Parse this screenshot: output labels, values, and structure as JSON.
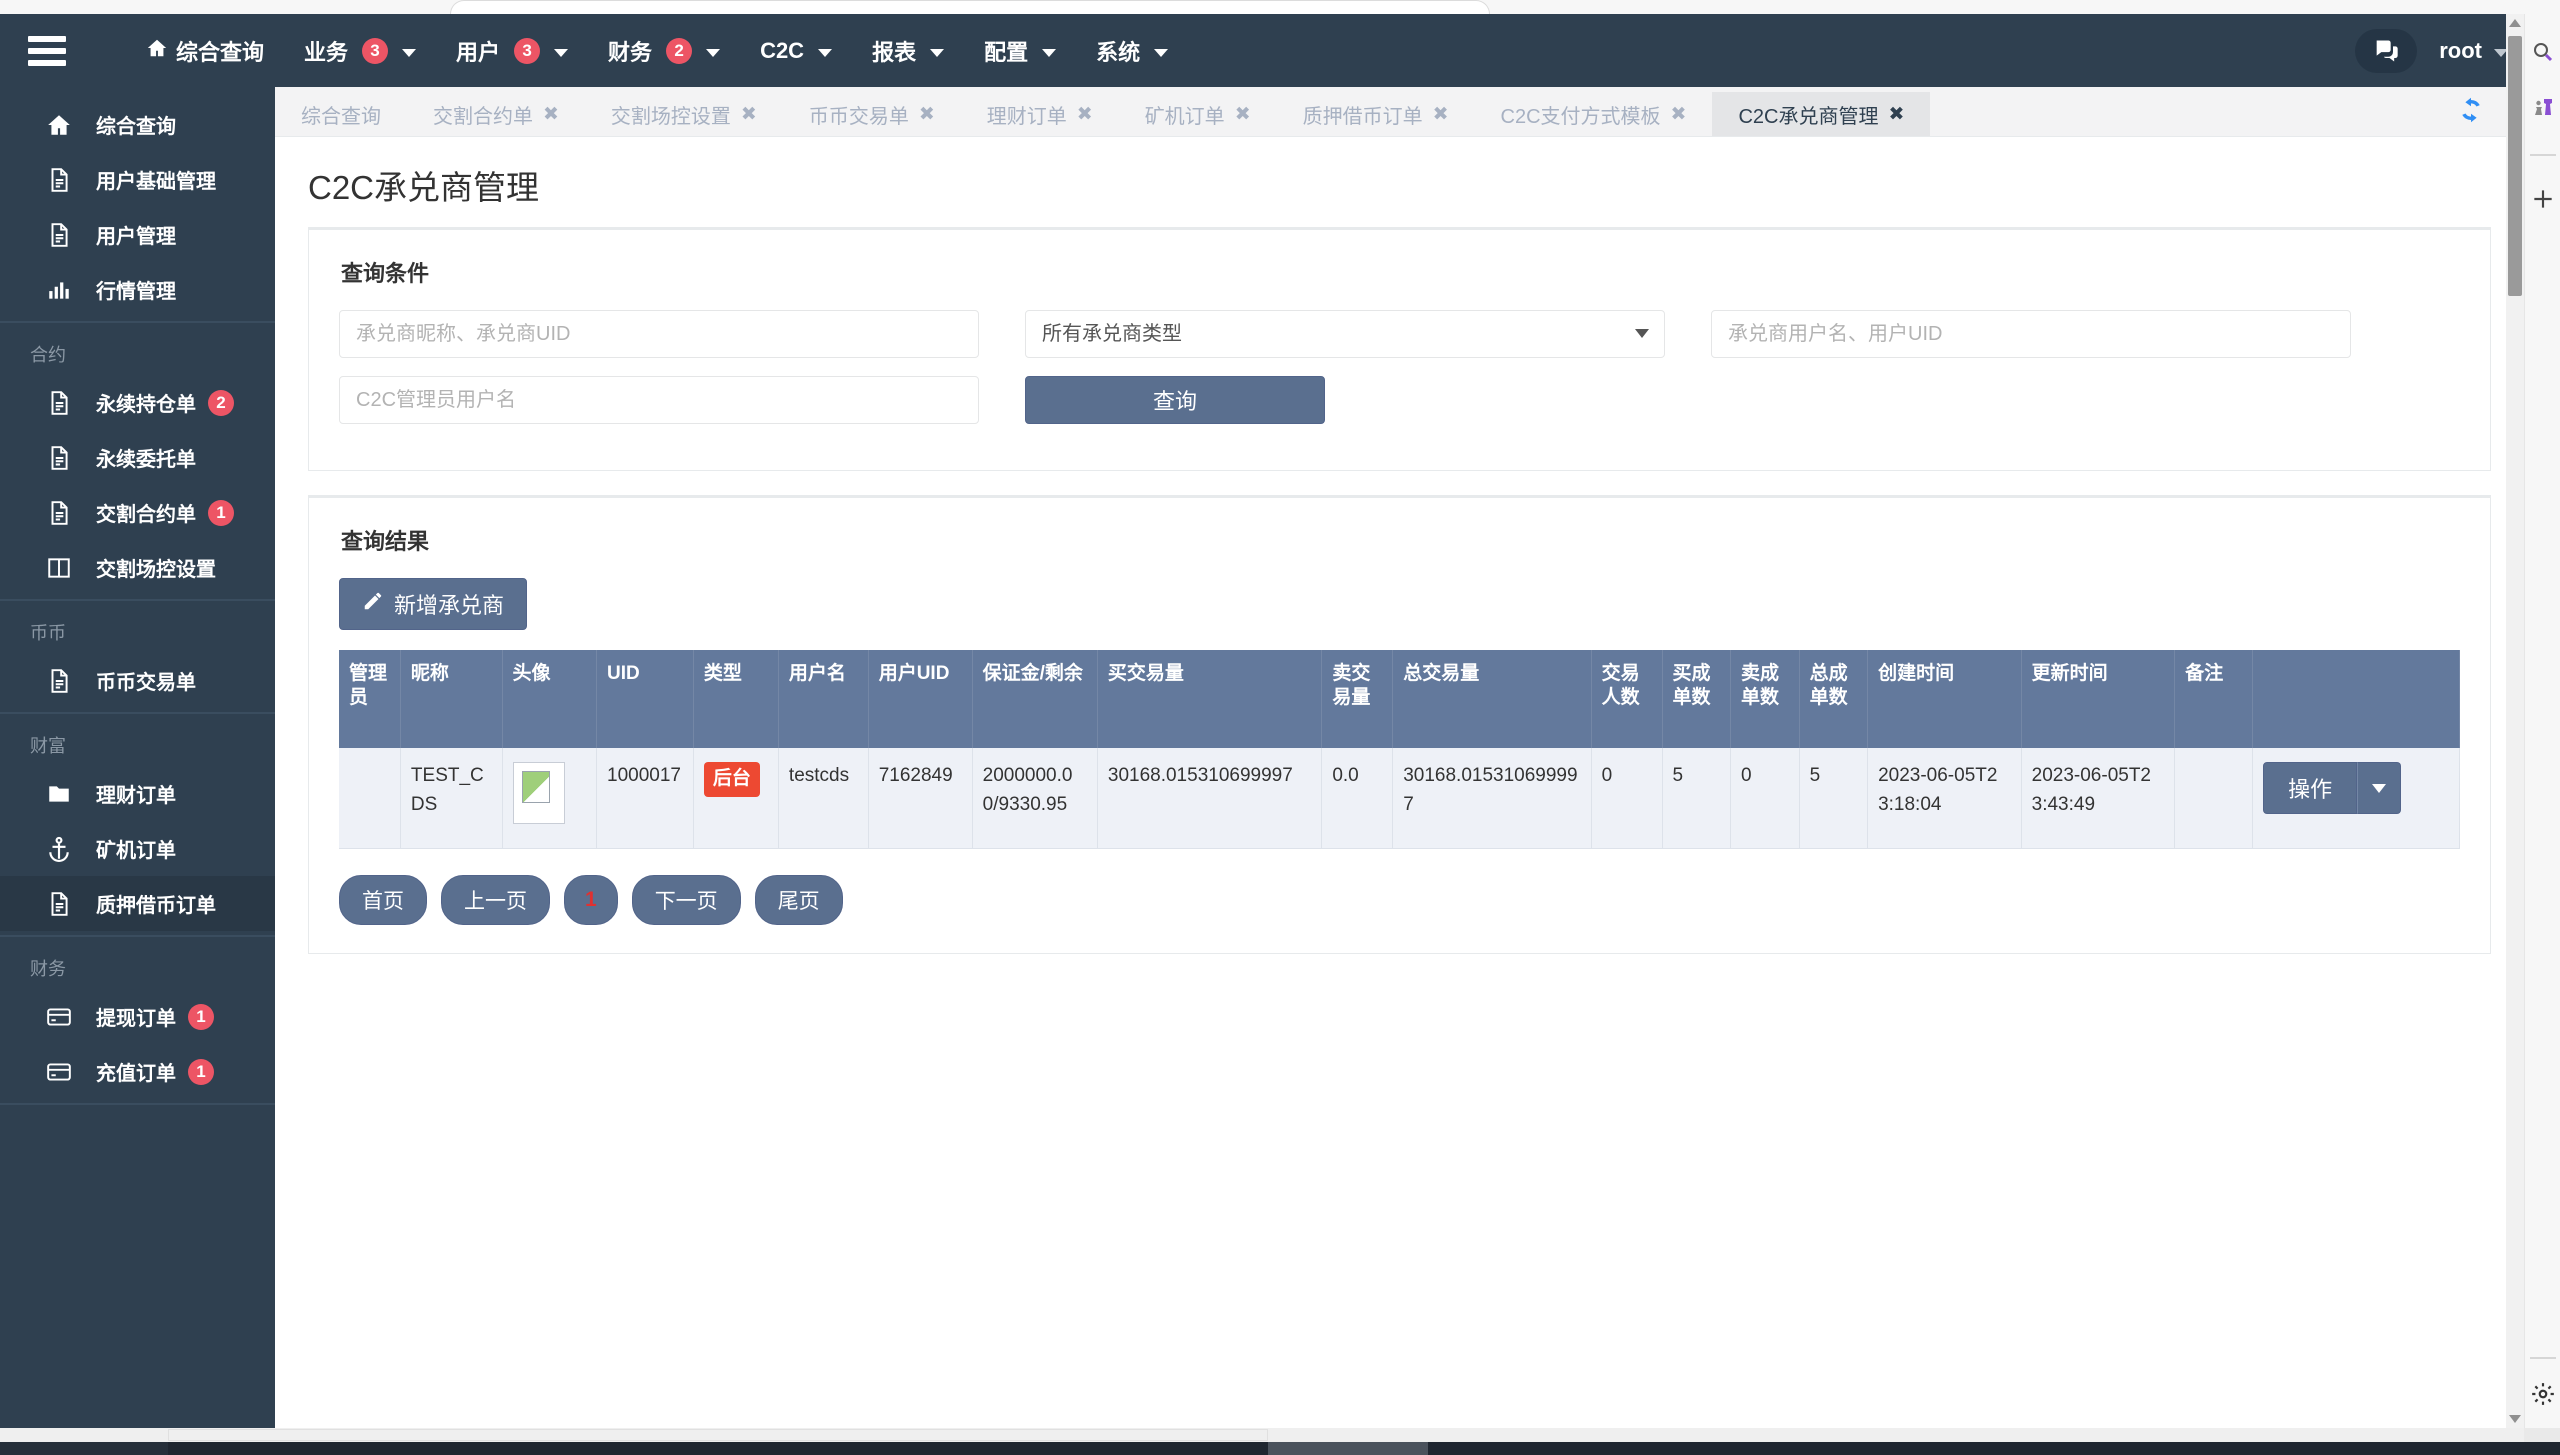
{
  "navbar": {
    "hamburger": "menu-icon",
    "items": [
      {
        "label": "综合查询",
        "icon": "home-icon",
        "badge": null,
        "caret": false
      },
      {
        "label": "业务",
        "icon": null,
        "badge": "3",
        "caret": true
      },
      {
        "label": "用户",
        "icon": null,
        "badge": "3",
        "caret": true
      },
      {
        "label": "财务",
        "icon": null,
        "badge": "2",
        "caret": true
      },
      {
        "label": "C2C",
        "icon": null,
        "badge": null,
        "caret": true
      },
      {
        "label": "报表",
        "icon": null,
        "badge": null,
        "caret": true
      },
      {
        "label": "配置",
        "icon": null,
        "badge": null,
        "caret": true
      },
      {
        "label": "系统",
        "icon": null,
        "badge": null,
        "caret": true
      }
    ],
    "chat_icon": "chat-bubbles-icon",
    "user": "root"
  },
  "sidebar": {
    "groups": [
      {
        "title": null,
        "items": [
          {
            "label": "综合查询",
            "icon": "home-icon",
            "badge": null,
            "active": false
          },
          {
            "label": "用户基础管理",
            "icon": "file-icon",
            "badge": null,
            "active": false
          },
          {
            "label": "用户管理",
            "icon": "file-icon",
            "badge": null,
            "active": false
          },
          {
            "label": "行情管理",
            "icon": "chart-bar-icon",
            "badge": null,
            "active": false
          }
        ]
      },
      {
        "title": "合约",
        "items": [
          {
            "label": "永续持仓单",
            "icon": "file-icon",
            "badge": "2",
            "active": false
          },
          {
            "label": "永续委托单",
            "icon": "file-icon",
            "badge": null,
            "active": false
          },
          {
            "label": "交割合约单",
            "icon": "file-icon",
            "badge": "1",
            "active": false
          },
          {
            "label": "交割场控设置",
            "icon": "columns-icon",
            "badge": null,
            "active": false
          }
        ]
      },
      {
        "title": "币币",
        "items": [
          {
            "label": "币币交易单",
            "icon": "file-icon",
            "badge": null,
            "active": false
          }
        ]
      },
      {
        "title": "财富",
        "items": [
          {
            "label": "理财订单",
            "icon": "folder-icon",
            "badge": null,
            "active": false
          },
          {
            "label": "矿机订单",
            "icon": "anchor-icon",
            "badge": null,
            "active": false
          },
          {
            "label": "质押借币订单",
            "icon": "file-icon",
            "badge": null,
            "active": true
          }
        ]
      },
      {
        "title": "财务",
        "items": [
          {
            "label": "提现订单",
            "icon": "credit-card-icon",
            "badge": "1",
            "active": false
          },
          {
            "label": "充值订单",
            "icon": "credit-card-icon",
            "badge": "1",
            "active": false
          }
        ]
      }
    ]
  },
  "tabs": {
    "items": [
      {
        "label": "综合查询",
        "closable": false,
        "active": false
      },
      {
        "label": "交割合约单",
        "closable": true,
        "active": false
      },
      {
        "label": "交割场控设置",
        "closable": true,
        "active": false
      },
      {
        "label": "币币交易单",
        "closable": true,
        "active": false
      },
      {
        "label": "理财订单",
        "closable": true,
        "active": false
      },
      {
        "label": "矿机订单",
        "closable": true,
        "active": false
      },
      {
        "label": "质押借币订单",
        "closable": true,
        "active": false
      },
      {
        "label": "C2C支付方式模板",
        "closable": true,
        "active": false
      },
      {
        "label": "C2C承兑商管理",
        "closable": true,
        "active": true
      }
    ],
    "close_glyph": "✖",
    "refresh_icon": "refresh-icon"
  },
  "page": {
    "title": "C2C承兑商管理",
    "search_panel": {
      "heading": "查询条件",
      "merchant_input_placeholder": "承兑商昵称、承兑商UID",
      "type_select_value": "所有承兑商类型",
      "user_input_placeholder": "承兑商用户名、用户UID",
      "admin_input_placeholder": "C2C管理员用户名",
      "query_button": "查询"
    },
    "result_panel": {
      "heading": "查询结果",
      "add_button": "新增承兑商",
      "add_button_icon": "pencil-icon",
      "columns": [
        "管理员",
        "昵称",
        "头像",
        "UID",
        "类型",
        "用户名",
        "用户UID",
        "保证金/剩余",
        "买交易量",
        "卖交易量",
        "总交易量",
        "交易人数",
        "买成单数",
        "卖成单数",
        "总成单数",
        "创建时间",
        "更新时间",
        "备注",
        ""
      ],
      "rows": [
        {
          "admin": "",
          "nickname": "TEST_CDS",
          "avatar": "broken-image-icon",
          "uid": "1000017",
          "type": "后台",
          "username": "testcds",
          "user_uid": "7162849",
          "margin": "2000000.00/9330.95",
          "buy_volume": "30168.015310699997",
          "sell_volume": "0.0",
          "total_volume": "30168.015310699997",
          "trade_users": "0",
          "buy_orders": "5",
          "sell_orders": "0",
          "total_orders": "5",
          "create_time": "2023-06-05T23:18:04",
          "update_time": "2023-06-05T23:43:49",
          "remark": "",
          "action_label": "操作"
        }
      ],
      "pagination": {
        "first": "首页",
        "prev": "上一页",
        "current": "1",
        "next": "下一页",
        "last": "尾页"
      }
    }
  },
  "right_rail": {
    "icons": [
      "search-icon",
      "chess-pieces-icon",
      "plus-icon",
      "gear-icon"
    ]
  },
  "colors": {
    "navbar_bg": "#2f4050",
    "sidebar_bg": "#2f4050",
    "sidebar_active": "#293846",
    "badge_red": "#ed5565",
    "table_header": "#63799c",
    "table_row": "#eef1f7",
    "primary_button": "#5a6f8f",
    "type_badge": "#ed4932",
    "current_page": "#e03131"
  }
}
